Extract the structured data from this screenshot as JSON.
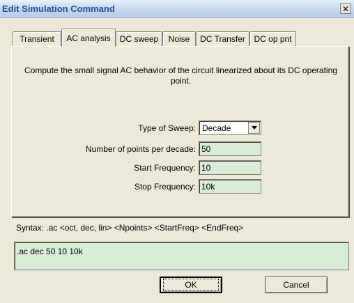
{
  "window": {
    "title": "Edit Simulation Command",
    "close_glyph": "✕"
  },
  "tabs": [
    {
      "label": "Transient"
    },
    {
      "label": "AC analysis"
    },
    {
      "label": "DC sweep"
    },
    {
      "label": "Noise"
    },
    {
      "label": "DC Transfer"
    },
    {
      "label": "DC op pnt"
    }
  ],
  "selected_tab": "AC analysis",
  "description": "Compute the small signal AC behavior of the circuit linearized about its DC operating point.",
  "form": {
    "sweep_type": {
      "label": "Type of Sweep:",
      "value": "Decade"
    },
    "points": {
      "label": "Number of points per decade:",
      "value": "50"
    },
    "start_freq": {
      "label": "Start Frequency:",
      "value": "10"
    },
    "stop_freq": {
      "label": "Stop Frequency:",
      "value": "10k"
    }
  },
  "syntax": "Syntax: .ac <oct, dec, lin> <Npoints> <StartFreq> <EndFreq>",
  "command_text": ".ac dec 50 10 10k",
  "buttons": {
    "ok": "OK",
    "cancel": "Cancel"
  }
}
